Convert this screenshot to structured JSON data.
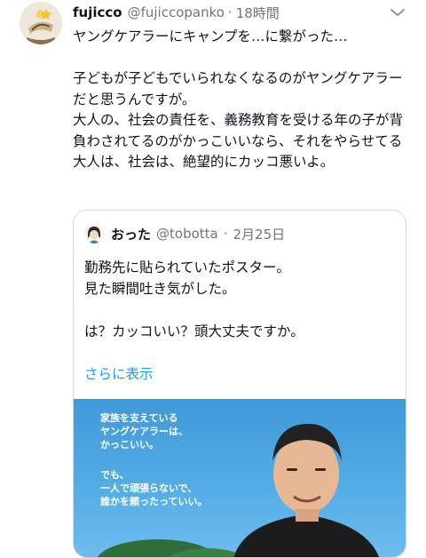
{
  "tweet": {
    "name": "fujicco",
    "handle": "@fujiccopanko",
    "separator": "·",
    "time": "18時間",
    "body": "ヤングケアラーにキャンプを…に繋がった…\n\n子どもが子どもでいられなくなるのがヤングケアラーだと思うんですが。\n大人の、社会の責任を、義務教育を受ける年の子が背負わされてるのがかっこいいなら、それをやらせてる大人は、社会は、絶望的にカッコ悪いよ。"
  },
  "quote": {
    "name": "おった",
    "handle": "@tobotta",
    "separator": "·",
    "date": "2月25日",
    "body": "勤務先に貼られていたポスター。\n見た瞬間吐き気がした。\n\nは？カッコいい？頭大丈夫ですか。",
    "show_more": "さらに表示",
    "poster_lines_1": "家族を支えている\nヤングケアラーは、\nかっこいい。",
    "poster_lines_2": "でも、\n一人で頑張らないで、\n誰かを頼ったっていい。"
  },
  "icons": {
    "more": "chevron-down-icon",
    "avatar": "avatar-illustration"
  },
  "colors": {
    "link": "#1d9bf0",
    "muted": "#6e767d",
    "border": "#cfd9de",
    "poster_sky": "#4aa5e0"
  }
}
